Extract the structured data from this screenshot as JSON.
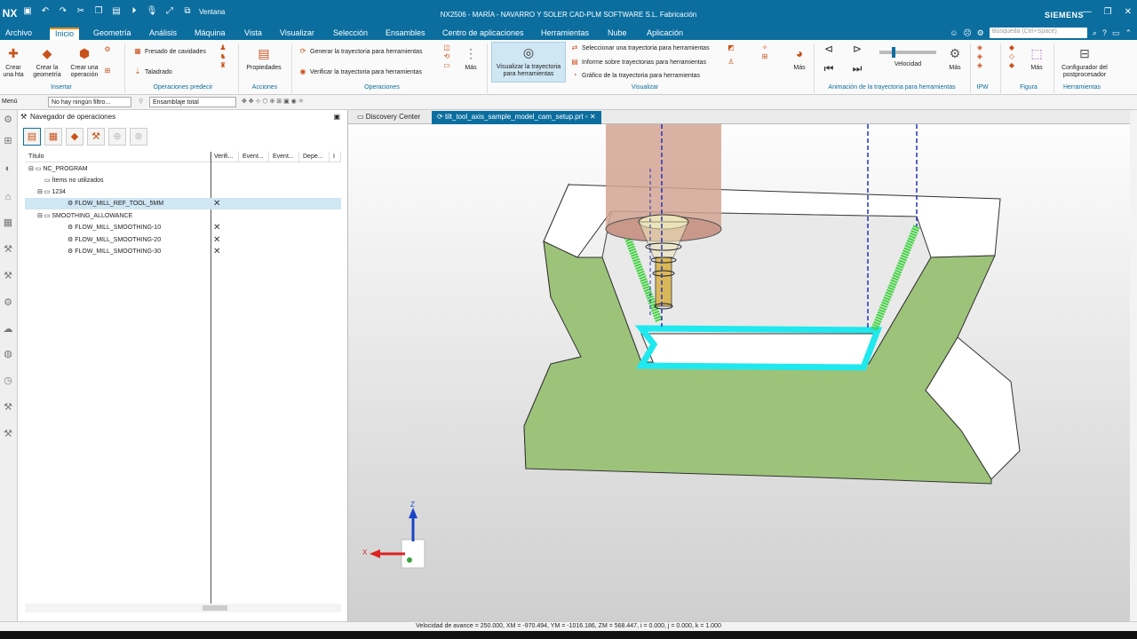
{
  "app": {
    "logo": "NX",
    "window_title": "NX2506 - MARÍA - NAVARRO Y SOLER CAD-PLM SOFTWARE S.L. Fabricación",
    "brand": "SIEMENS",
    "window_menu": "Ventana"
  },
  "menu": {
    "items": [
      "Archivo",
      "Inicio",
      "Geometría",
      "Análisis",
      "Máquina",
      "Vista",
      "Visualizar",
      "Selección",
      "Ensambles",
      "Centro de aplicaciones",
      "Herramientas",
      "Nube",
      "Aplicación"
    ],
    "active": "Inicio",
    "search_placeholder": "Búsqueda (Ctrl+Space)"
  },
  "ribbon": {
    "crear_hta": "Crear una hta",
    "crear_geometria": "Crear la geometría",
    "crear_operacion": "Crear una operación",
    "group_insertar": "Insertar",
    "fresado_cavidades": "Fresado de cavidades",
    "taladrado": "Taladrado",
    "group_operaciones_predecir": "Operaciones predecir",
    "propiedades": "Propiedades",
    "group_acciones": "Acciones",
    "generar": "Generar la trayectoria para herramientas",
    "verificar": "Verificar la trayectoria para herramientas",
    "mas1": "Más",
    "group_operaciones": "Operaciones",
    "visualizar_trayectoria": "Visualizar la trayectoria para herramientas",
    "seleccionar": "Seleccionar una trayectoria para herramientas",
    "informe": "Informe sobre trayectorias para herramientas",
    "grafico": "Gráfico de la trayectoria para herramientas",
    "mas2": "Más",
    "group_visualizar": "Visualizar",
    "velocidad": "Velocidad",
    "mas3": "Más",
    "group_animacion": "Animación de la trayectoria para herramientas",
    "group_ipw": "IPW",
    "mas4": "Más",
    "group_figura": "Figura",
    "configurador": "Configurador del postprocesador",
    "group_herramientas": "Herramientas"
  },
  "toolbar2": {
    "menu": "Menú",
    "filter": "No hay ningún filtro...",
    "assembly": "Ensamblaje total"
  },
  "navigator": {
    "title": "Navegador de operaciones",
    "columns": [
      "Título",
      "Verifi...",
      "Event...",
      "Event...",
      "Depe...",
      "I"
    ],
    "rows": [
      {
        "label": "NC_PROGRAM",
        "checked": false
      },
      {
        "label": "Ítems no utilizados",
        "checked": false
      },
      {
        "label": "1234",
        "checked": false
      },
      {
        "label": "FLOW_MILL_REF_TOOL_5MM",
        "checked": true
      },
      {
        "label": "SMOOTHING_ALLOWANCE",
        "checked": false
      },
      {
        "label": "FLOW_MILL_SMOOTHING-10",
        "checked": true
      },
      {
        "label": "FLOW_MILL_SMOOTHING-20",
        "checked": true
      },
      {
        "label": "FLOW_MILL_SMOOTHING-30",
        "checked": true
      }
    ]
  },
  "tabs": {
    "discovery": "Discovery Center",
    "part": "tilt_tool_axis_sample_model_cam_setup.prt"
  },
  "triad": {
    "z": "Z",
    "x": "X"
  },
  "status": "Velocidad de avance = 250.000, XM = -970.494, YM = -1016.186, ZM = 568.447, i = 0.000, j = 0.000, k = 1.000",
  "colors": {
    "brand": "#0b6e9f",
    "part": "#9dc37a",
    "toolpath_green": "#3fd33f",
    "toolpath_cyan": "#1fe8ee",
    "tool_holder": "#d4a493"
  }
}
